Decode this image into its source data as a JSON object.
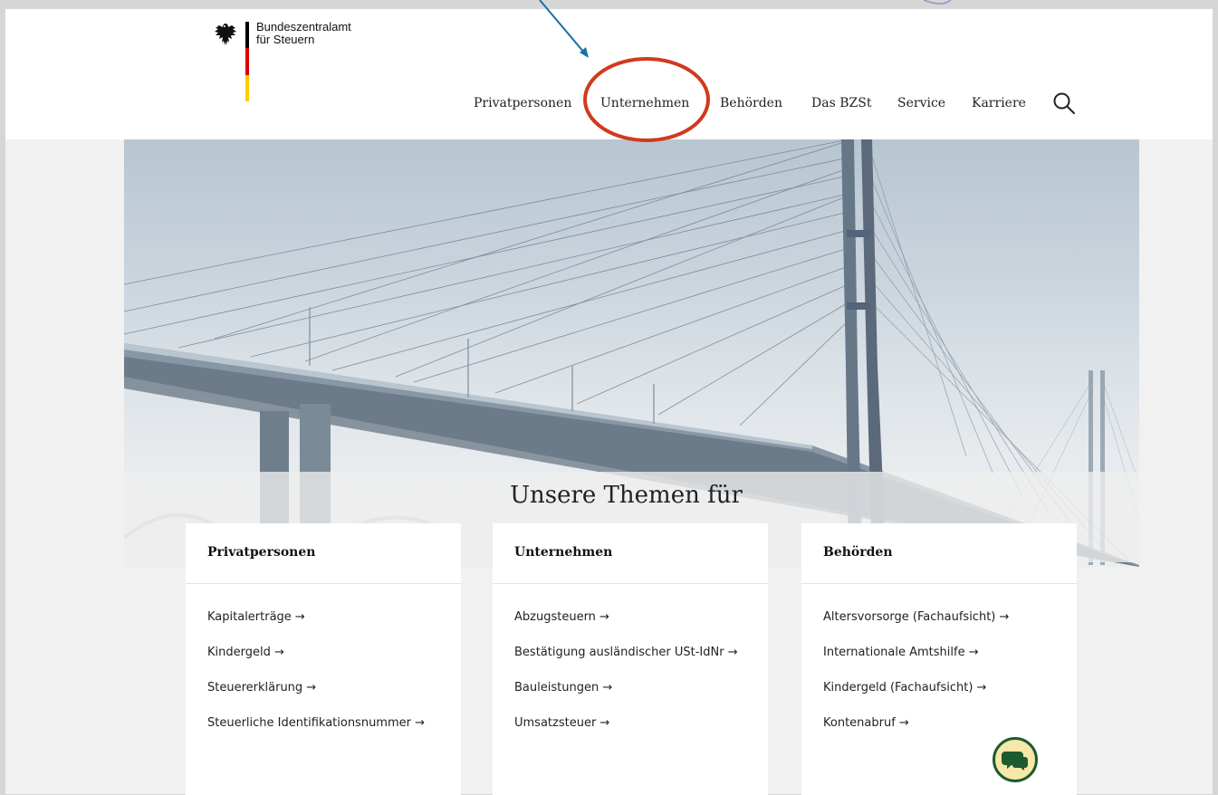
{
  "brand": {
    "line1": "Bundeszentralamt",
    "line2": "für Steuern"
  },
  "nav": {
    "items": [
      {
        "label": "Privatpersonen"
      },
      {
        "label": "Unternehmen"
      },
      {
        "label": "Behörden"
      },
      {
        "label": "Das BZSt"
      },
      {
        "label": "Service"
      },
      {
        "label": "Karriere"
      }
    ]
  },
  "icons": {
    "search": "search-icon",
    "chat": "chat-icon",
    "eagle": "eagle-icon"
  },
  "colors": {
    "annotation_circle": "#d03a1e",
    "annotation_arrow": "#1a6fa8",
    "chat_bg": "#f7e7a8",
    "chat_border": "#1d5a2f"
  },
  "themes": {
    "title": "Unsere Themen für",
    "cards": [
      {
        "title": "Privatpersonen",
        "links": [
          "Kapitalerträge →",
          "Kindergeld →",
          "Steuererklärung →",
          "Steuerliche Identifikationsnummer →"
        ]
      },
      {
        "title": "Unternehmen",
        "links": [
          "Abzugsteuern →",
          "Bestätigung ausländischer USt-IdNr →",
          "Bauleistungen →",
          "Umsatzsteuer →"
        ]
      },
      {
        "title": "Behörden",
        "links": [
          "Altersvorsorge (Fachaufsicht) →",
          "Internationale Amtshilfe →",
          "Kindergeld (Fachaufsicht) →",
          "Kontenabruf →"
        ]
      }
    ]
  }
}
